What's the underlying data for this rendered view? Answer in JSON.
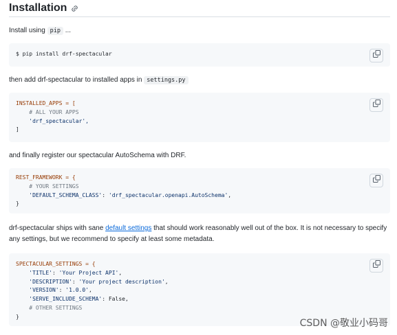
{
  "heading": {
    "title": "Installation",
    "link_icon": "link-icon"
  },
  "intro": {
    "text": "Install using ",
    "code": "pip",
    "suffix": " ..."
  },
  "block1": {
    "lines": [
      "$ pip install drf-spectacular"
    ]
  },
  "p2": {
    "text": "then add drf-spectacular to installed apps in ",
    "code": "settings.py"
  },
  "block2": {
    "l1": "INSTALLED_APPS = [",
    "l2": "    # ALL YOUR APPS",
    "l3": "    'drf_spectacular',",
    "l4": "]"
  },
  "p3": {
    "text": "and finally register our spectacular AutoSchema with DRF."
  },
  "block3": {
    "l1": "REST_FRAMEWORK = {",
    "l2": "    # YOUR SETTINGS",
    "l3a": "    'DEFAULT_SCHEMA_CLASS'",
    "l3b": ": ",
    "l3c": "'drf_spectacular.openapi.AutoSchema'",
    "l3d": ",",
    "l4": "}"
  },
  "p4": {
    "before": "drf-spectacular ships with sane ",
    "link": "default settings",
    "after": " that should work reasonably well out of the box. It is not necessary to specify any settings, but we recommend to specify at least some metadata."
  },
  "block4": {
    "l1": "SPECTACULAR_SETTINGS = {",
    "l2a": "    'TITLE'",
    "l2b": ": ",
    "l2c": "'Your Project API'",
    "l2d": ",",
    "l3a": "    'DESCRIPTION'",
    "l3b": ": ",
    "l3c": "'Your project description'",
    "l3d": ",",
    "l4a": "    'VERSION'",
    "l4b": ": ",
    "l4c": "'1.0.0'",
    "l4d": ",",
    "l5a": "    'SERVE_INCLUDE_SCHEMA'",
    "l5b": ": False,",
    "l6": "    # OTHER SETTINGS",
    "l7": "}"
  },
  "copy_icon": "copy-icon",
  "watermark": "CSDN @敬业小码哥"
}
